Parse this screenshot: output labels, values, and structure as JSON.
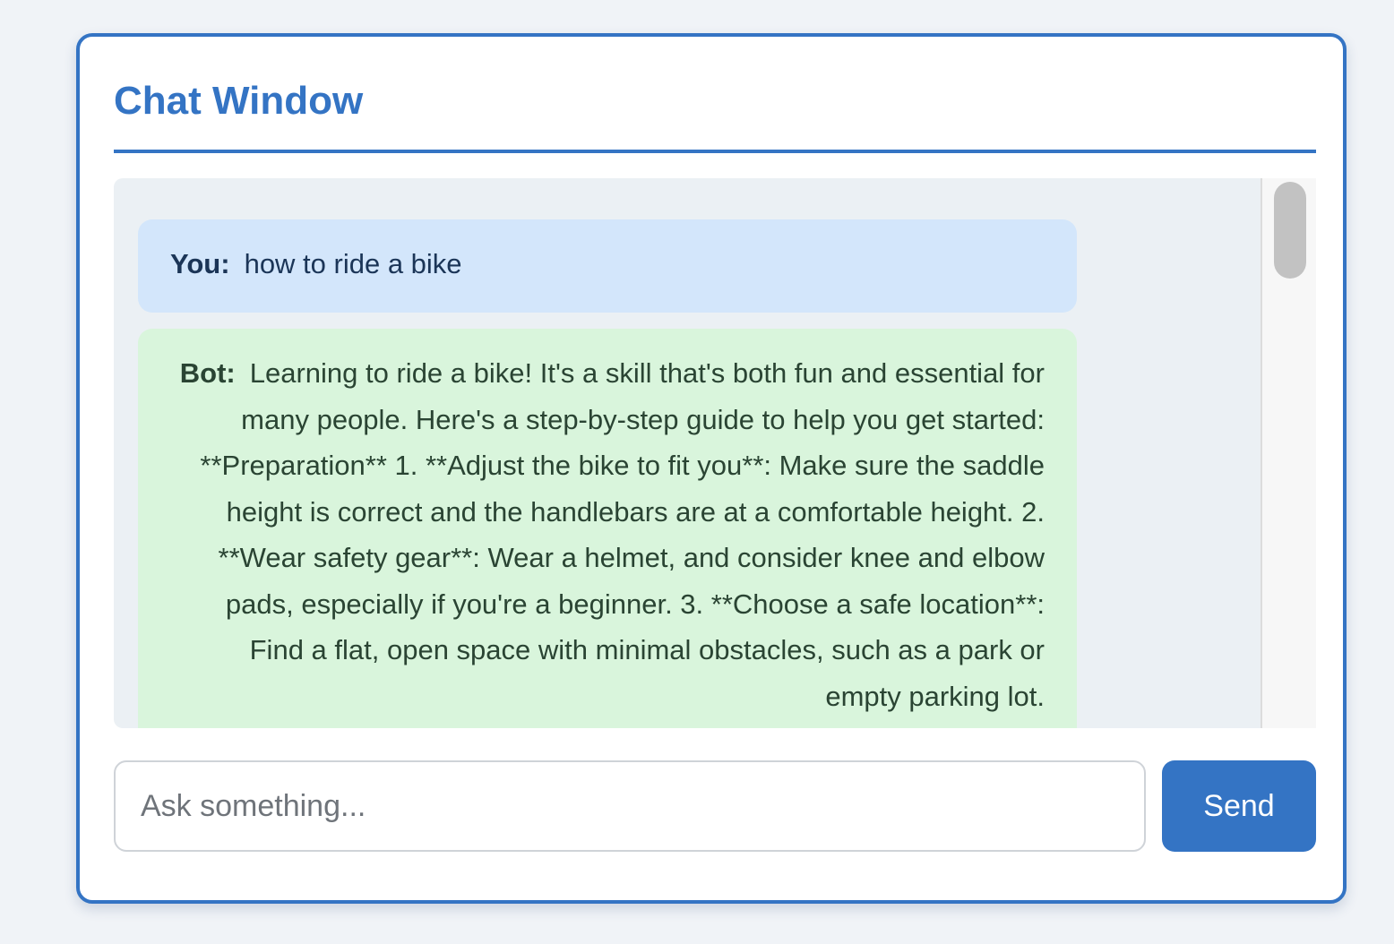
{
  "window": {
    "title": "Chat Window"
  },
  "messages": [
    {
      "speaker": "You:",
      "text": "how to ride a bike"
    },
    {
      "speaker": "Bot:",
      "text": "Learning to ride a bike! It's a skill that's both fun and essential for many people. Here's a step-by-step guide to help you get started: **Preparation** 1. **Adjust the bike to fit you**: Make sure the saddle height is correct and the handlebars are at a comfortable height. 2. **Wear safety gear**: Wear a helmet, and consider knee and elbow pads, especially if you're a beginner. 3. **Choose a safe location**: Find a flat, open space with minimal obstacles, such as a park or empty parking lot."
    }
  ],
  "input": {
    "placeholder": "Ask something...",
    "value": ""
  },
  "send_button": {
    "label": "Send"
  },
  "colors": {
    "accent": "#3474c4",
    "user_bubble": "#d3e6fb",
    "bot_bubble": "#d9f5dc",
    "messages_background": "#ebf0f4"
  }
}
